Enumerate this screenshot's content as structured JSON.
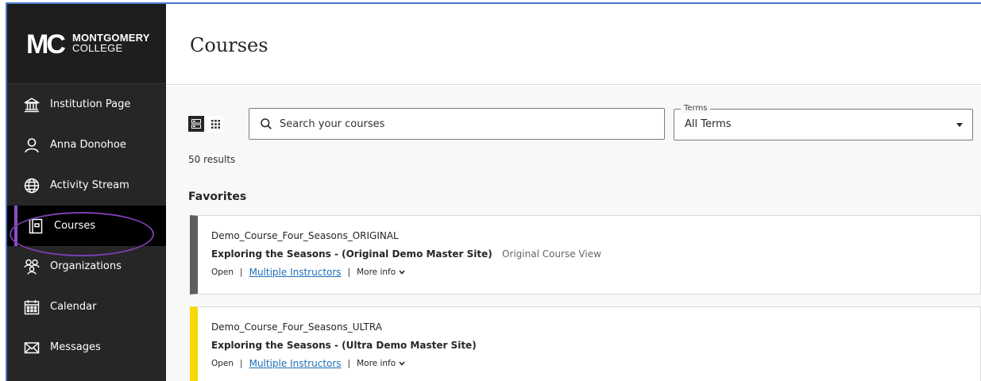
{
  "brand": {
    "logo_mark": "MC",
    "name_line1": "MONTGOMERY",
    "name_line2": "COLLEGE"
  },
  "sidebar": {
    "items": [
      {
        "label": "Institution Page",
        "icon": "institution-icon"
      },
      {
        "label": "Anna Donohoe",
        "icon": "user-icon"
      },
      {
        "label": "Activity Stream",
        "icon": "globe-icon"
      },
      {
        "label": "Courses",
        "icon": "courses-icon",
        "active": true
      },
      {
        "label": "Organizations",
        "icon": "organizations-icon"
      },
      {
        "label": "Calendar",
        "icon": "calendar-icon"
      },
      {
        "label": "Messages",
        "icon": "envelope-icon"
      }
    ]
  },
  "header": {
    "title": "Courses"
  },
  "toolbar": {
    "search_placeholder": "Search your courses",
    "terms_label": "Terms",
    "terms_value": "All Terms"
  },
  "results": {
    "count_text": "50 results"
  },
  "favorites": {
    "heading": "Favorites",
    "courses": [
      {
        "id": "Demo_Course_Four_Seasons_ORIGINAL",
        "name": "Exploring the Seasons - (Original Demo Master Site)",
        "view": "Original Course View",
        "status": "Open",
        "instructors": "Multiple Instructors",
        "more_info": "More info",
        "accent_color": "#5e5e5e"
      },
      {
        "id": "Demo_Course_Four_Seasons_ULTRA",
        "name": "Exploring the Seasons - (Ultra Demo Master Site)",
        "view": "",
        "status": "Open",
        "instructors": "Multiple Instructors",
        "more_info": "More info",
        "accent_color": "#f5d90a"
      }
    ]
  },
  "colors": {
    "sidebar_bg": "#262626",
    "active_indicator": "#8c4fc4",
    "highlight_oval": "#7a3fb0",
    "link": "#1e6fb8"
  }
}
